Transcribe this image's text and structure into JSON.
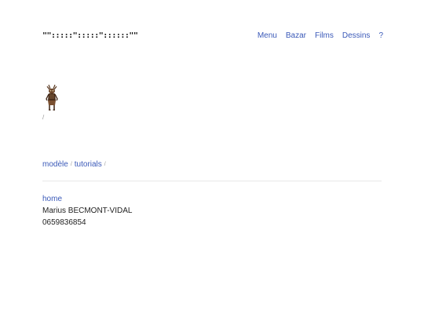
{
  "header": {
    "logo_text": "\"\":::::\":::::\"::::::\"\"",
    "nav": [
      {
        "label": "Menu"
      },
      {
        "label": "Bazar"
      },
      {
        "label": "Films"
      },
      {
        "label": "Dessins"
      },
      {
        "label": "?"
      }
    ]
  },
  "content": {
    "figure_icon": "totem-figure-image",
    "slash": "/"
  },
  "breadcrumbs": {
    "items": [
      {
        "label": "modèle"
      },
      {
        "label": "tutorials"
      }
    ],
    "separator": "/"
  },
  "footer": {
    "home_link": "home",
    "name": "Marius BECMONT-VIDAL",
    "phone": "0659836854"
  },
  "colors": {
    "link": "#3a59b8",
    "divider": "#e8e8e8"
  }
}
